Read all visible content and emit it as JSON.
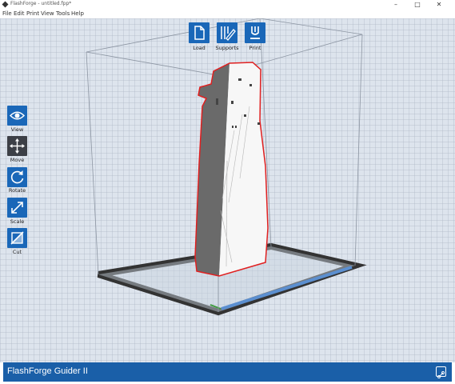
{
  "window": {
    "title": "FlashForge - untitled.fpp*"
  },
  "menu": [
    "File",
    "Edit",
    "Print",
    "View",
    "Tools",
    "Help"
  ],
  "top_toolbar": [
    {
      "label": "Load",
      "icon": "file-icon"
    },
    {
      "label": "Supports",
      "icon": "supports-icon"
    },
    {
      "label": "Print",
      "icon": "print-icon"
    }
  ],
  "side_toolbar": [
    {
      "label": "View",
      "icon": "eye-icon",
      "active": false
    },
    {
      "label": "Move",
      "icon": "move-icon",
      "active": true
    },
    {
      "label": "Rotate",
      "icon": "rotate-icon",
      "active": false
    },
    {
      "label": "Scale",
      "icon": "scale-icon",
      "active": false
    },
    {
      "label": "Cut",
      "icon": "cut-icon",
      "active": false
    }
  ],
  "status": {
    "printer_name": "FlashForge Guider II"
  },
  "colors": {
    "accent": "#1a67b8",
    "status_bar": "#1a5fa8",
    "active_tool": "#3c3f46",
    "viewport_bg": "#dde4ed",
    "model_outline": "#e02020"
  }
}
